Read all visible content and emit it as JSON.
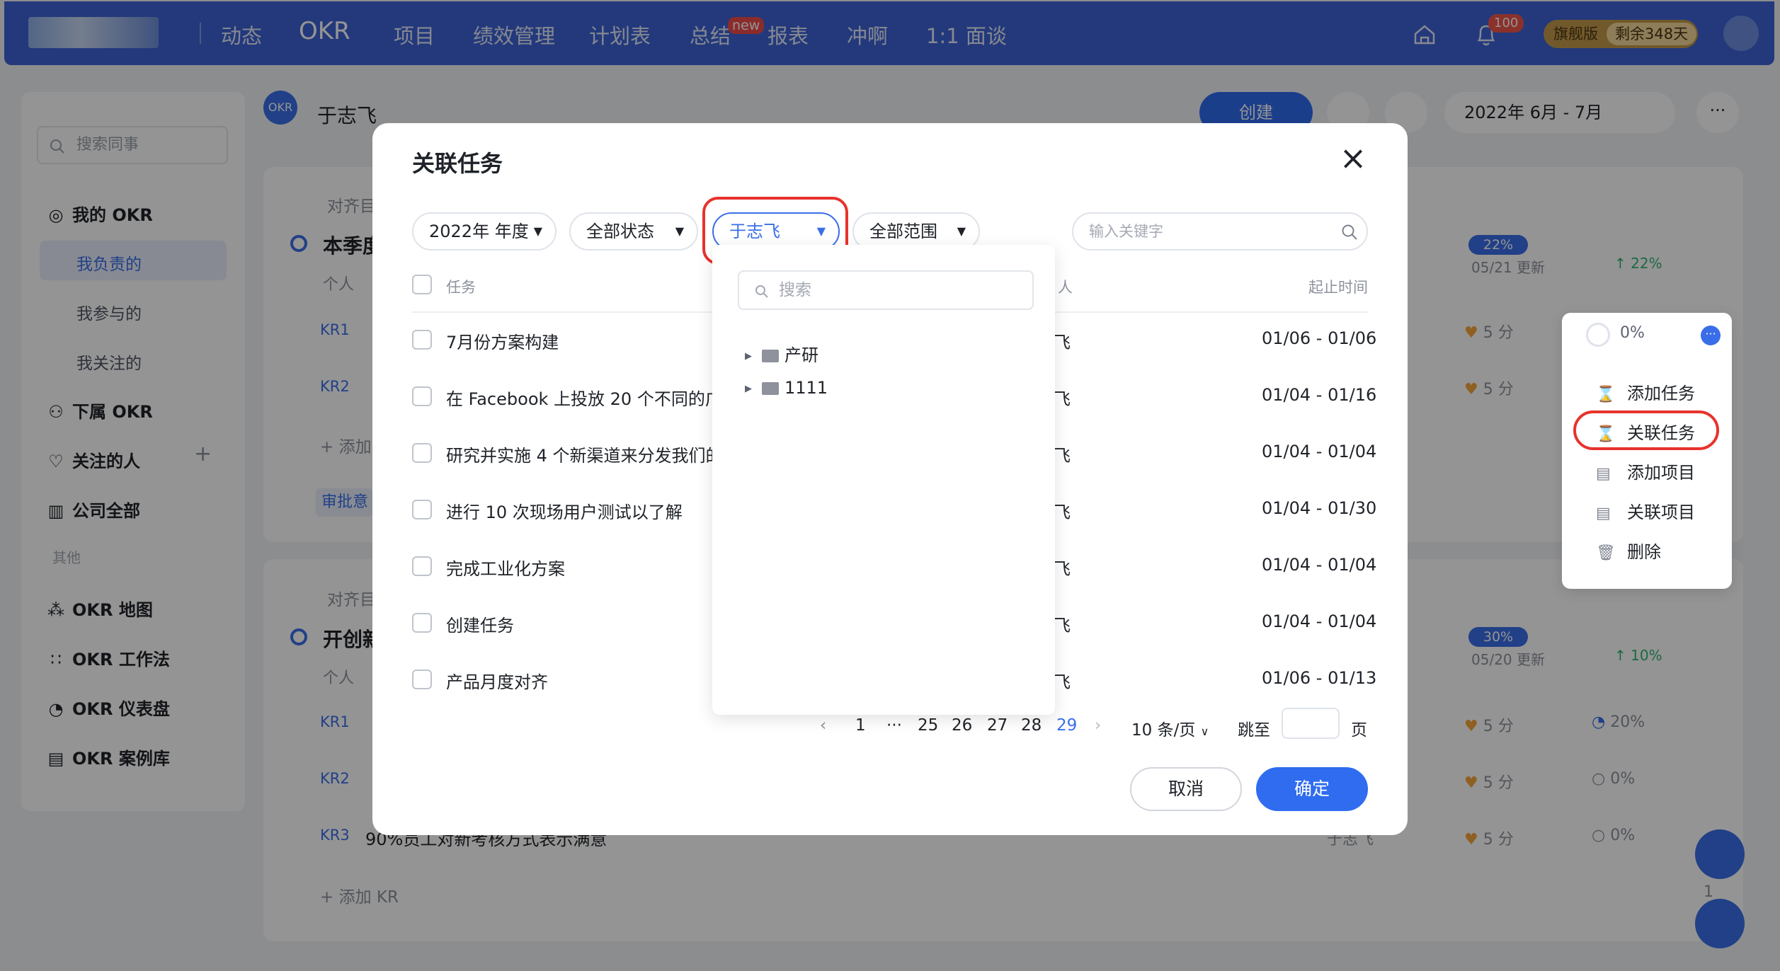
{
  "topnav": {
    "items": [
      "动态",
      "OKR",
      "项目",
      "绩效管理",
      "计划表",
      "总结",
      "报表",
      "冲啊",
      "1:1 面谈"
    ],
    "new_badge": "new",
    "bell_count": "100",
    "vip_label": "旗舰版",
    "vip_days": "剩余348天"
  },
  "sidebar": {
    "search_placeholder": "搜索同事",
    "my_okr": "我的 OKR",
    "sub": [
      "我负责的",
      "我参与的",
      "我关注的"
    ],
    "sub_okr": "下属 OKR",
    "follow": "关注的人",
    "company": "公司全部",
    "other": "其他",
    "tools": [
      "OKR 地图",
      "OKR 工作法",
      "OKR 仪表盘",
      "OKR 案例库"
    ]
  },
  "main": {
    "user_name": "于志飞",
    "create_btn": "创建",
    "period": "2022年 6月 - 7月",
    "align": "对齐目",
    "obj1_title": "本季度",
    "obj2_title": "开创新",
    "personal": "个人",
    "kr_labels": [
      "KR1",
      "KR2",
      "KR1",
      "KR2",
      "KR3"
    ],
    "kr3_text": "90%员工对新考核方式表示满意",
    "kr3_owner": "于志飞",
    "add_kr": "+ 添加 KR",
    "add_short": "+ 添加",
    "approve": "审批意",
    "progress1": "22%",
    "update1": "05/21 更新",
    "delta1": "↑ 22%",
    "progress2": "30%",
    "update2": "05/20 更新",
    "delta2": "↑ 10%",
    "score": "5 分",
    "pct20": "20%",
    "pct0": "0%",
    "count": "1"
  },
  "context_menu": {
    "progress": "0%",
    "items": [
      "添加任务",
      "关联任务",
      "添加项目",
      "关联项目",
      "删除"
    ]
  },
  "dialog": {
    "title": "关联任务",
    "filters": {
      "year": "2022年 年度",
      "status": "全部状态",
      "person": "于志飞",
      "scope": "全部范围"
    },
    "keyword_placeholder": "输入关键字",
    "columns": {
      "task": "任务",
      "owner": "人",
      "time": "起止时间"
    },
    "rows": [
      {
        "task": "7月份方案构建",
        "owner": "飞",
        "date": "01/06 - 01/06"
      },
      {
        "task": "在 Facebook 上投放 20 个不同的广",
        "owner": "飞",
        "date": "01/04 - 01/16"
      },
      {
        "task": "研究并实施 4 个新渠道来分发我们的",
        "owner": "飞",
        "date": "01/04 - 01/04"
      },
      {
        "task": "进行 10 次现场用户测试以了解",
        "owner": "飞",
        "date": "01/04 - 01/30"
      },
      {
        "task": "完成工业化方案",
        "owner": "飞",
        "date": "01/04 - 01/04"
      },
      {
        "task": "创建任务",
        "owner": "飞",
        "date": "01/04 - 01/04"
      },
      {
        "task": "产品月度对齐",
        "owner": "飞",
        "date": "01/06 - 01/13"
      }
    ],
    "pagination": {
      "prev": "‹",
      "pages": [
        "1",
        "···",
        "25",
        "26",
        "27",
        "28",
        "29"
      ],
      "next": "›",
      "page_size": "10 条/页",
      "jump_label": "跳至",
      "page_unit": "页"
    },
    "cancel": "取消",
    "ok": "确定"
  },
  "dropdown": {
    "search_placeholder": "搜索",
    "nodes": [
      "产研",
      "1111"
    ]
  }
}
